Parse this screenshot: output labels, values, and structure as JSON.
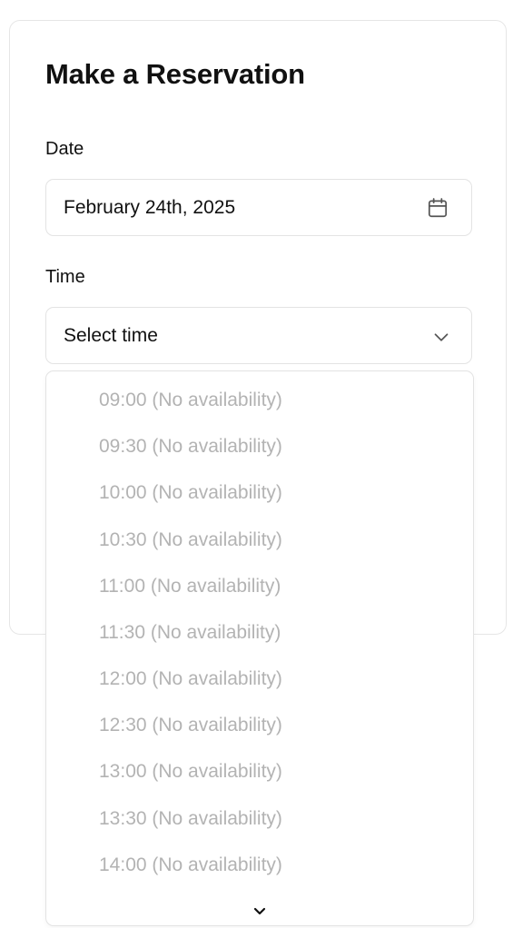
{
  "form": {
    "title": "Make a Reservation",
    "date_label": "Date",
    "date_value": "February 24th, 2025",
    "time_label": "Time",
    "time_placeholder": "Select time"
  },
  "icons": {
    "date_icon": "calendar-icon",
    "time_icon": "chevron-down-icon",
    "scroll_icon": "chevron-down-icon"
  },
  "time_options": [
    {
      "label": "09:00 (No availability)",
      "disabled": true
    },
    {
      "label": "09:30 (No availability)",
      "disabled": true
    },
    {
      "label": "10:00 (No availability)",
      "disabled": true
    },
    {
      "label": "10:30 (No availability)",
      "disabled": true
    },
    {
      "label": "11:00 (No availability)",
      "disabled": true
    },
    {
      "label": "11:30 (No availability)",
      "disabled": true
    },
    {
      "label": "12:00 (No availability)",
      "disabled": true
    },
    {
      "label": "12:30 (No availability)",
      "disabled": true
    },
    {
      "label": "13:00 (No availability)",
      "disabled": true
    },
    {
      "label": "13:30 (No availability)",
      "disabled": true
    },
    {
      "label": "14:00 (No availability)",
      "disabled": true
    }
  ],
  "colors": {
    "text": "#111111",
    "disabled_text": "#b3b3b3",
    "border": "#e3e3e3"
  }
}
